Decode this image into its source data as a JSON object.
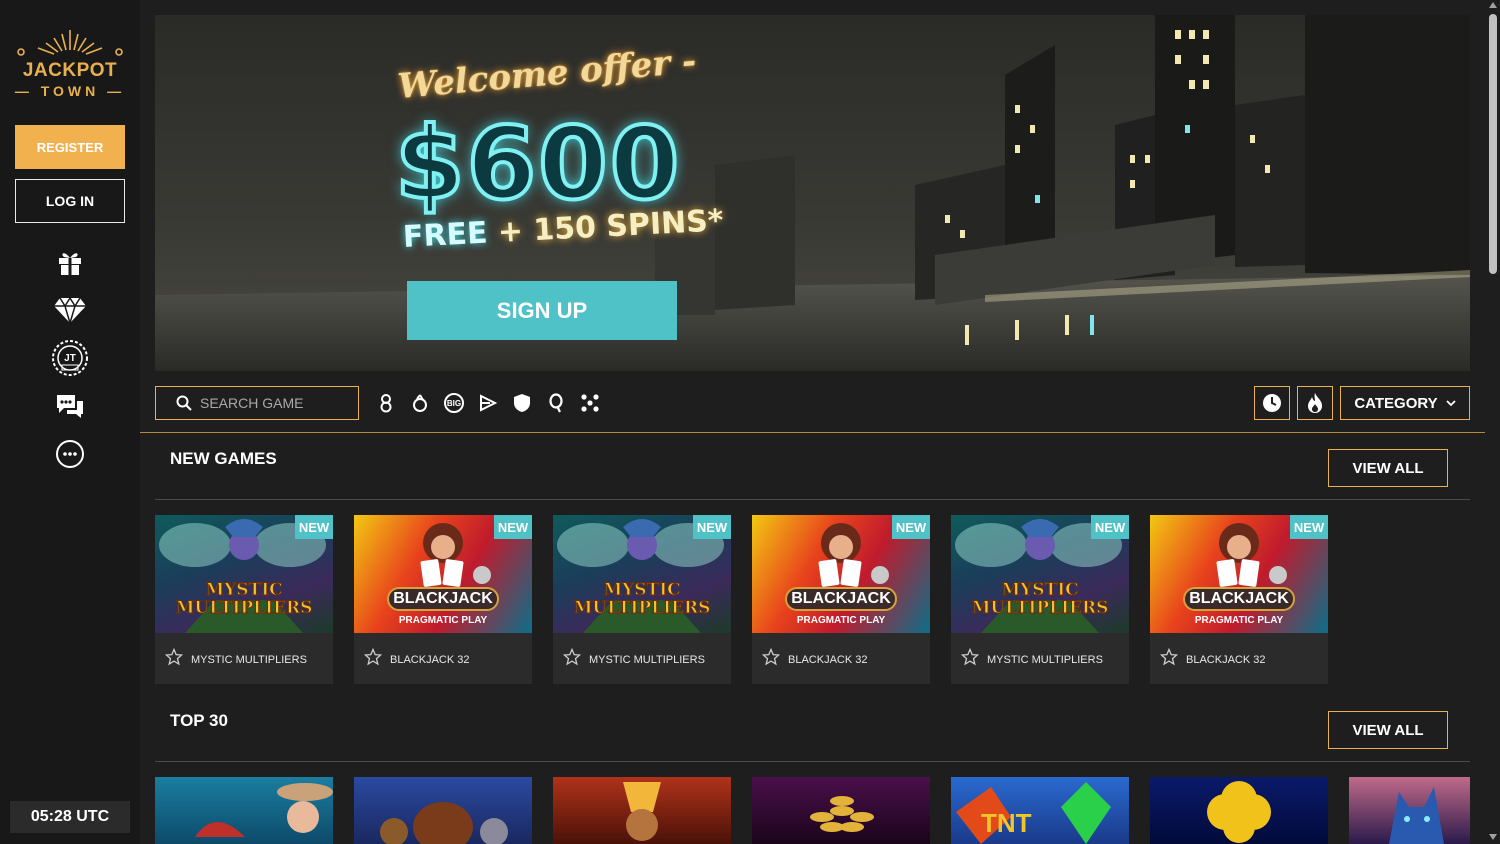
{
  "brand": {
    "word": "JACKPOT",
    "sub": "TOWN"
  },
  "sidebar": {
    "register_label": "REGISTER",
    "login_label": "LOG IN",
    "icons": [
      "gift-icon",
      "diamond-icon",
      "jt-vip-badge-icon",
      "chat-icon",
      "more-icon"
    ],
    "clock": "05:28 UTC"
  },
  "banner": {
    "welcome": "Welcome offer -",
    "amount": "$600",
    "free": "FREE",
    "spins": "+ 150 SPINS*",
    "signup_label": "SIGN UP"
  },
  "toolbar": {
    "search_placeholder": "SEARCH GAME",
    "providers": [
      "provider-8-icon",
      "provider-drop-icon",
      "provider-big-icon",
      "provider-play-icon",
      "provider-shield-icon",
      "provider-q-icon",
      "provider-dots-icon"
    ],
    "category_label": "CATEGORY"
  },
  "sections": {
    "new_games": {
      "title": "NEW GAMES",
      "view_all": "VIEW ALL"
    },
    "top30": {
      "title": "TOP 30",
      "view_all": "VIEW ALL"
    }
  },
  "new_games": [
    {
      "name": "MYSTIC MULTIPLIERS",
      "badge": "NEW",
      "art_line1": "MYSTIC",
      "art_line2": "MULTIPLIERS"
    },
    {
      "name": "BLACKJACK 32",
      "badge": "NEW",
      "art_line1": "BLACKJACK",
      "art_line2": "PRAGMATIC PLAY"
    },
    {
      "name": "MYSTIC MULTIPLIERS",
      "badge": "NEW",
      "art_line1": "MYSTIC",
      "art_line2": "MULTIPLIERS"
    },
    {
      "name": "BLACKJACK 32",
      "badge": "NEW",
      "art_line1": "BLACKJACK",
      "art_line2": "PRAGMATIC PLAY"
    },
    {
      "name": "MYSTIC MULTIPLIERS",
      "badge": "NEW",
      "art_line1": "MYSTIC",
      "art_line2": "MULTIPLIERS"
    },
    {
      "name": "BLACKJACK 32",
      "badge": "NEW",
      "art_line1": "BLACKJACK",
      "art_line2": "PRAGMATIC PLAY"
    }
  ],
  "colors": {
    "gold": "#e8b14d",
    "teal": "#4fc2c8",
    "bg": "#1e1e1e",
    "sidebar": "#181818"
  }
}
